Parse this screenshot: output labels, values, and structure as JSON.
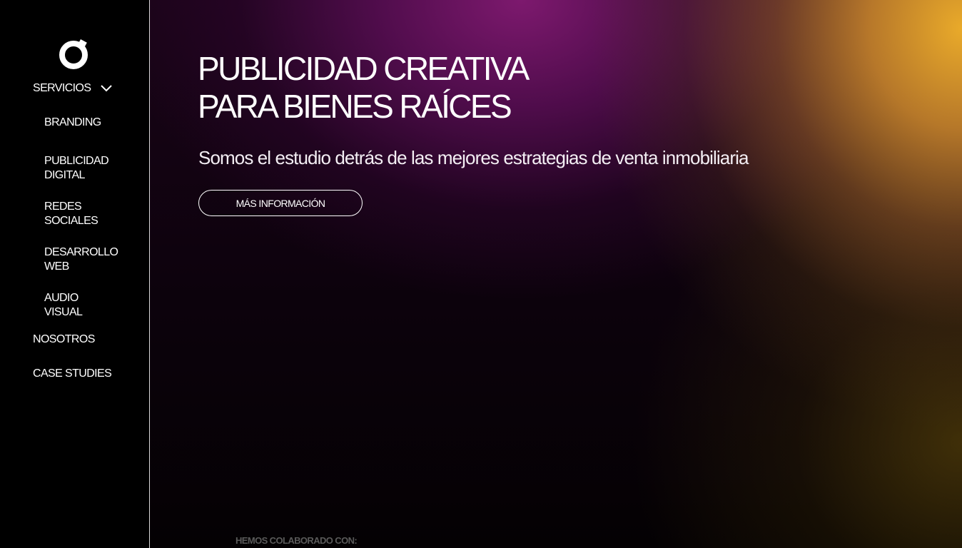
{
  "sidebar": {
    "logo_icon": "ring-logo-icon",
    "servicios_label": "SERVICIOS",
    "submenu": [
      {
        "line1": "BRANDING",
        "line2": ""
      },
      {
        "line1": "PUBLICIDAD",
        "line2": "DIGITAL"
      },
      {
        "line1": "REDES",
        "line2": "SOCIALES"
      },
      {
        "line1": "DESARROLLO",
        "line2": "WEB"
      },
      {
        "line1": "AUDIO",
        "line2": "VISUAL"
      }
    ],
    "nosotros_label": "NOSOTROS",
    "case_studies_label": "CASE STUDIES"
  },
  "hero": {
    "title_line1": "PUBLICIDAD CREATIVA",
    "title_line2": "PARA BIENES RAÍCES",
    "subtitle": "Somos el estudio detrás de las mejores estrategias de venta inmobiliaria",
    "cta_label": "MÁS INFORMACIÓN"
  },
  "collab_label": "HEMOS COLABORADO CON:",
  "colors": {
    "background": "#000000",
    "gradient_purple": "#7d196e",
    "gradient_gold": "#e9aa2a",
    "text": "#ffffff",
    "muted": "#5a5a5a"
  }
}
